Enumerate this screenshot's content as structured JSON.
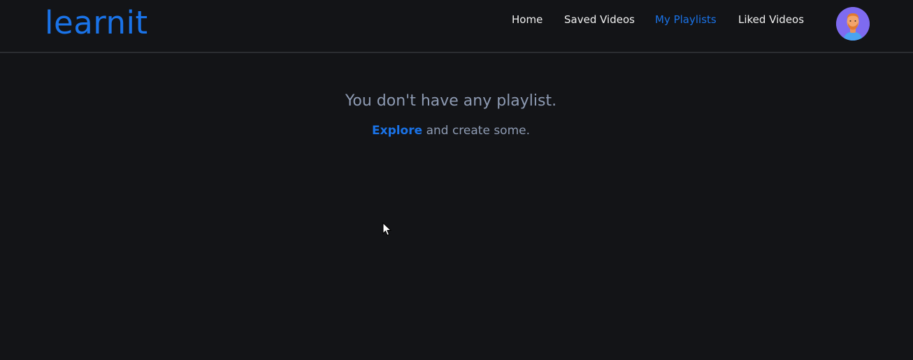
{
  "brand": {
    "logo_text": "learnit"
  },
  "nav": {
    "home": "Home",
    "saved": "Saved Videos",
    "playlists": "My Playlists",
    "liked": "Liked Videos",
    "active_item": "My Playlists"
  },
  "user": {
    "avatar_icon": "user-avatar-icon"
  },
  "empty_state": {
    "title": "You don't have any playlist.",
    "explore_link": "Explore",
    "rest": "and create some."
  },
  "colors": {
    "background": "#131417",
    "accent": "#1a73e8",
    "muted_text": "#8e9bb3",
    "nav_text": "#f1f1f1",
    "avatar_bg": "#7e6bf0"
  }
}
